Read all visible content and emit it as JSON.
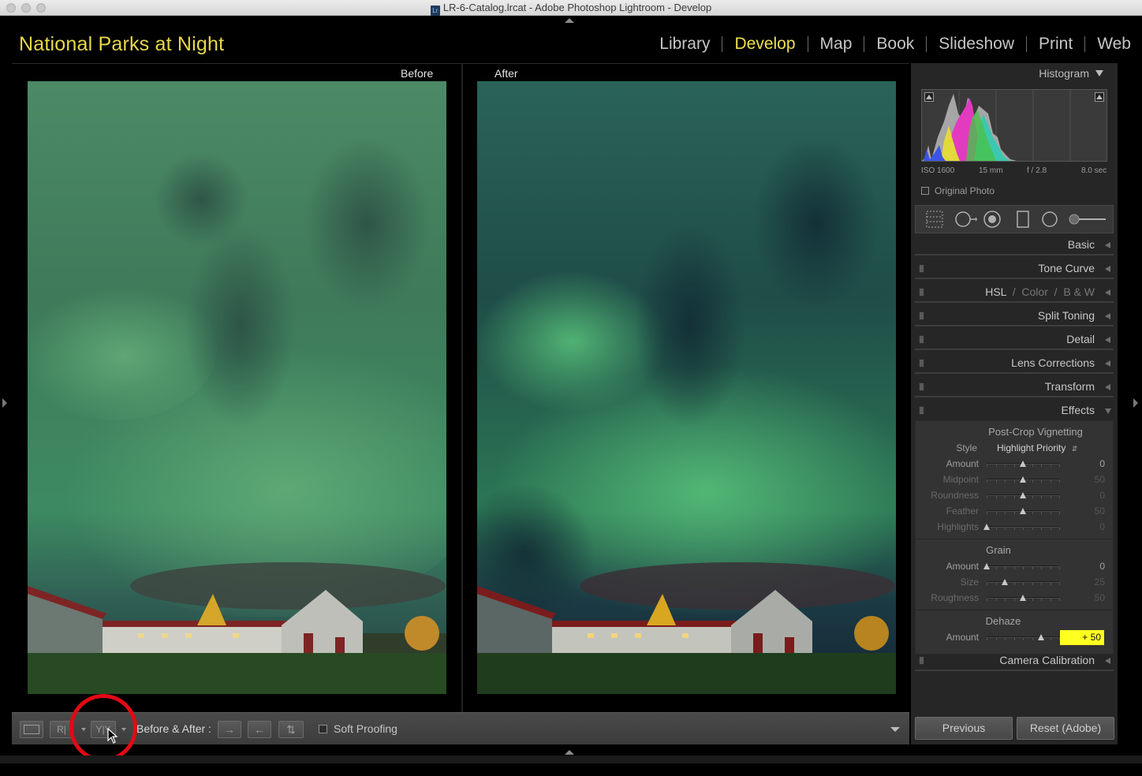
{
  "window": {
    "title": "LR-6-Catalog.lrcat - Adobe Photoshop Lightroom - Develop",
    "app_badge": "Lr"
  },
  "identity_plate": "National Parks at Night",
  "modules": [
    {
      "label": "Library",
      "active": false
    },
    {
      "label": "Develop",
      "active": true
    },
    {
      "label": "Map",
      "active": false
    },
    {
      "label": "Book",
      "active": false
    },
    {
      "label": "Slideshow",
      "active": false
    },
    {
      "label": "Print",
      "active": false
    },
    {
      "label": "Web",
      "active": false
    }
  ],
  "view": {
    "before_label": "Before",
    "after_label": "After"
  },
  "toolbar": {
    "loupe_label": "",
    "ba_side_label": "R|",
    "ba_split_label": "Y|Y",
    "before_after_label": "Before & After :",
    "copy_before_to_after": "→",
    "copy_after_to_before": "←",
    "swap": "⇅",
    "soft_proofing_label": "Soft Proofing",
    "soft_proofing_checked": false
  },
  "histogram": {
    "title": "Histogram",
    "iso": "ISO 1600",
    "focal": "15 mm",
    "aperture": "f / 2.8",
    "shutter": "8.0 sec",
    "original_photo_label": "Original Photo"
  },
  "sections": [
    {
      "title": "Basic",
      "has_switch": false
    },
    {
      "title": "Tone Curve",
      "has_switch": true
    },
    {
      "title": "HSL",
      "title2": "Color",
      "title3": "B & W",
      "has_switch": true
    },
    {
      "title": "Split Toning",
      "has_switch": true
    },
    {
      "title": "Detail",
      "has_switch": true
    },
    {
      "title": "Lens Corrections",
      "has_switch": true
    },
    {
      "title": "Transform",
      "has_switch": true
    },
    {
      "title": "Effects",
      "has_switch": true,
      "expanded": true
    },
    {
      "title": "Camera Calibration",
      "has_switch": true
    }
  ],
  "effects": {
    "vignette": {
      "title": "Post-Crop Vignetting",
      "style_label": "Style",
      "style_value": "Highlight Priority",
      "sliders": [
        {
          "label": "Amount",
          "value": "0",
          "pos": 0.5,
          "dim": false
        },
        {
          "label": "Midpoint",
          "value": "50",
          "pos": 0.5,
          "dim": true
        },
        {
          "label": "Roundness",
          "value": "0",
          "pos": 0.5,
          "dim": true
        },
        {
          "label": "Feather",
          "value": "50",
          "pos": 0.5,
          "dim": true
        },
        {
          "label": "Highlights",
          "value": "0",
          "pos": 0.0,
          "dim": true
        }
      ]
    },
    "grain": {
      "title": "Grain",
      "sliders": [
        {
          "label": "Amount",
          "value": "0",
          "pos": 0.0,
          "dim": false
        },
        {
          "label": "Size",
          "value": "25",
          "pos": 0.25,
          "dim": true
        },
        {
          "label": "Roughness",
          "value": "50",
          "pos": 0.5,
          "dim": true
        }
      ]
    },
    "dehaze": {
      "title": "Dehaze",
      "label": "Amount",
      "value": "+ 50",
      "pos": 0.75
    }
  },
  "buttons": {
    "previous": "Previous",
    "reset": "Reset (Adobe)"
  },
  "colors": {
    "accent": "#ede04e",
    "annotation": "#e10a14",
    "highlight": "#ffff20"
  }
}
